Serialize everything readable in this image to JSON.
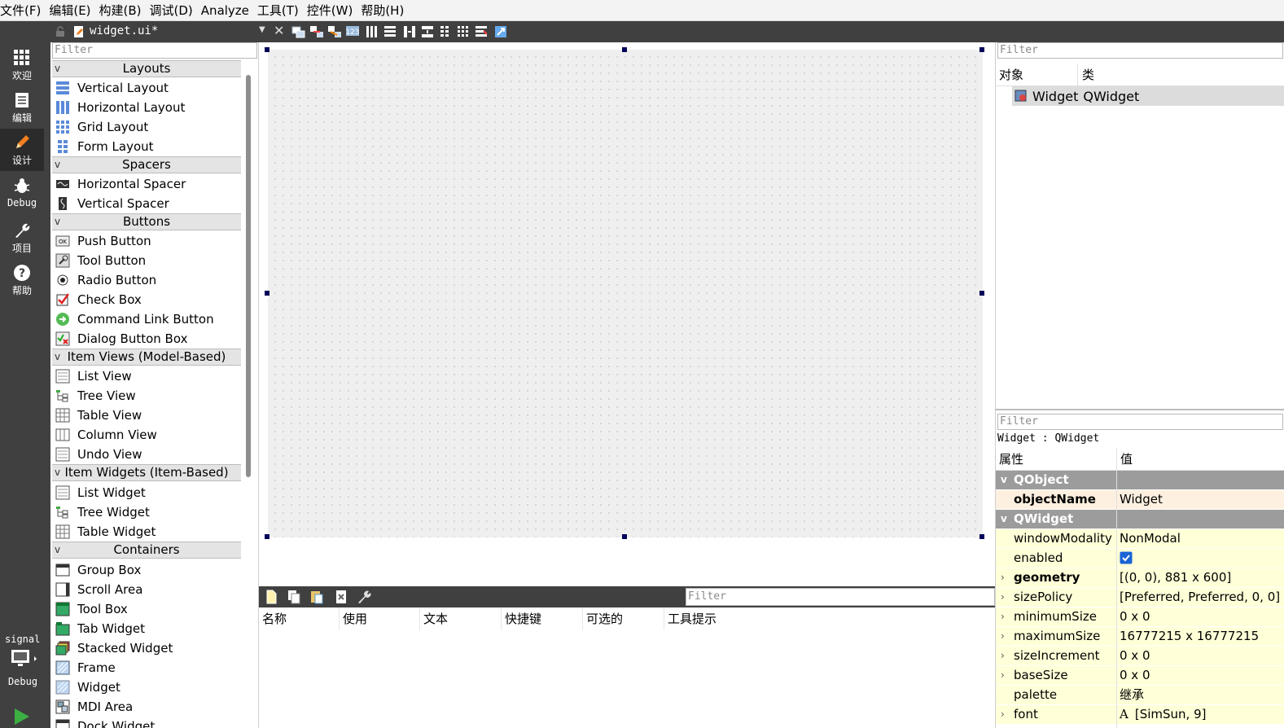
{
  "menu": [
    "文件(F)",
    "编辑(E)",
    "构建(B)",
    "调试(D)",
    "Analyze",
    "工具(T)",
    "控件(W)",
    "帮助(H)"
  ],
  "modes": [
    {
      "label": "欢迎",
      "icon": "grid-icon"
    },
    {
      "label": "编辑",
      "icon": "document-icon"
    },
    {
      "label": "设计",
      "icon": "pencil-icon"
    },
    {
      "label": "Debug",
      "icon": "bug-icon"
    },
    {
      "label": "项目",
      "icon": "wrench-icon"
    },
    {
      "label": "帮助",
      "icon": "help-icon"
    }
  ],
  "kit": {
    "project": "signal",
    "mode": "Debug"
  },
  "document": {
    "title": "widget.ui*"
  },
  "widget_box": {
    "filter_placeholder": "Filter",
    "categories": [
      {
        "name": "Layouts",
        "items": [
          "Vertical Layout",
          "Horizontal Layout",
          "Grid Layout",
          "Form Layout"
        ]
      },
      {
        "name": "Spacers",
        "items": [
          "Horizontal Spacer",
          "Vertical Spacer"
        ]
      },
      {
        "name": "Buttons",
        "items": [
          "Push Button",
          "Tool Button",
          "Radio Button",
          "Check Box",
          "Command Link Button",
          "Dialog Button Box"
        ]
      },
      {
        "name": "Item Views (Model-Based)",
        "items": [
          "List View",
          "Tree View",
          "Table View",
          "Column View",
          "Undo View"
        ]
      },
      {
        "name": "Item Widgets (Item-Based)",
        "items": [
          "List Widget",
          "Tree Widget",
          "Table Widget"
        ]
      },
      {
        "name": "Containers",
        "items": [
          "Group Box",
          "Scroll Area",
          "Tool Box",
          "Tab Widget",
          "Stacked Widget",
          "Frame",
          "Widget",
          "MDI Area",
          "Dock Widget"
        ]
      }
    ]
  },
  "action_editor": {
    "filter_placeholder": "Filter",
    "columns": [
      "名称",
      "使用",
      "文本",
      "快捷键",
      "可选的",
      "工具提示"
    ]
  },
  "object_inspector": {
    "filter_placeholder": "Filter",
    "columns": [
      "对象",
      "类"
    ],
    "row": {
      "object": "Widget",
      "class": "QWidget"
    }
  },
  "property_editor": {
    "filter_placeholder": "Filter",
    "class_label": "Widget : QWidget",
    "columns": [
      "属性",
      "值"
    ],
    "rows": [
      {
        "type": "group",
        "name": "QObject"
      },
      {
        "name": "objectName",
        "value": "Widget",
        "bold": true,
        "color": "#fdf0e0"
      },
      {
        "type": "group",
        "name": "QWidget"
      },
      {
        "name": "windowModality",
        "value": "NonModal",
        "color": "#ffffd8"
      },
      {
        "name": "enabled",
        "value": "",
        "checkbox": true,
        "checked": true,
        "color": "#ffffd8"
      },
      {
        "name": "geometry",
        "value": "[(0, 0), 881 x 600]",
        "bold": true,
        "expandable": true,
        "color": "#ffffd8"
      },
      {
        "name": "sizePolicy",
        "value": "[Preferred, Preferred, 0, 0]",
        "expandable": true,
        "color": "#ffffd8"
      },
      {
        "name": "minimumSize",
        "value": "0 x 0",
        "expandable": true,
        "color": "#ffffd8"
      },
      {
        "name": "maximumSize",
        "value": "16777215 x 16777215",
        "expandable": true,
        "color": "#ffffd8"
      },
      {
        "name": "sizeIncrement",
        "value": "0 x 0",
        "expandable": true,
        "color": "#ffffd8"
      },
      {
        "name": "baseSize",
        "value": "0 x 0",
        "expandable": true,
        "color": "#ffffd8"
      },
      {
        "name": "palette",
        "value": "继承",
        "color": "#ffffd8"
      },
      {
        "name": "font",
        "value": "[SimSun, 9]",
        "expandable": true,
        "font_glyph": "A",
        "color": "#ffffd8"
      }
    ]
  },
  "colors": {
    "sidebar": "#404040",
    "group_row": "#9c9c9c",
    "selection_handle": "#00005a"
  }
}
